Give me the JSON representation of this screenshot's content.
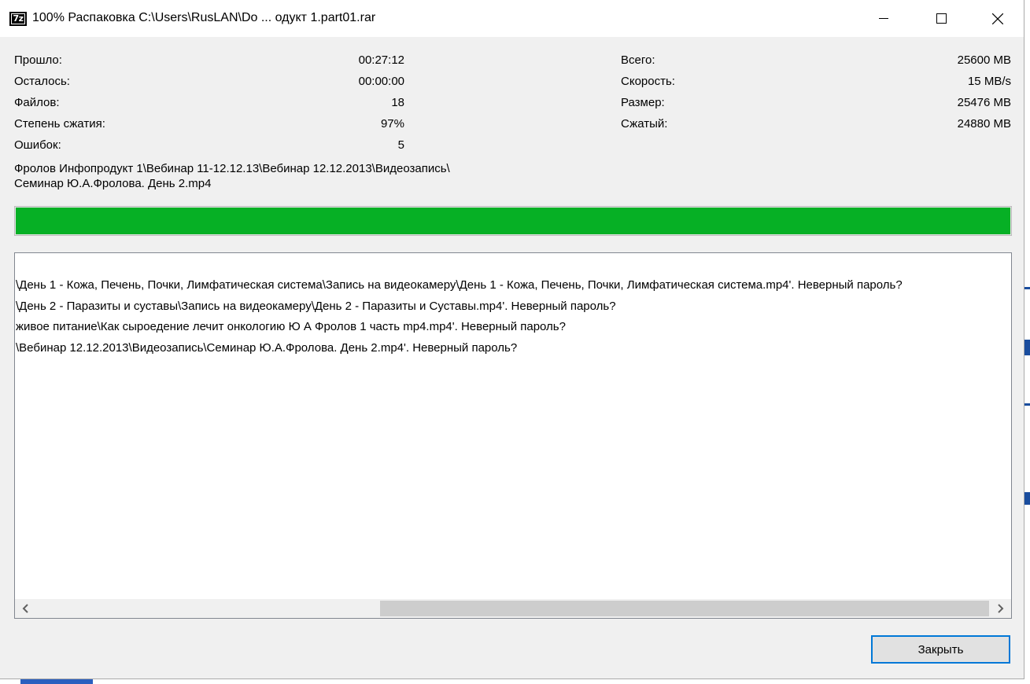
{
  "window": {
    "title": "100% Распаковка C:\\Users\\RusLAN\\Do ... одукт 1.part01.rar",
    "app_icon": "7z"
  },
  "stats_left": [
    {
      "label": "Прошло:",
      "value": "00:27:12"
    },
    {
      "label": "Осталось:",
      "value": "00:00:00"
    },
    {
      "label": "Файлов:",
      "value": "18"
    },
    {
      "label": "Степень сжатия:",
      "value": "97%"
    },
    {
      "label": "Ошибок:",
      "value": "5"
    }
  ],
  "stats_right": [
    {
      "label": "Всего:",
      "value": "25600 MB"
    },
    {
      "label": "Скорость:",
      "value": "15 MB/s"
    },
    {
      "label": "Размер:",
      "value": "25476 MB"
    },
    {
      "label": "Сжатый:",
      "value": "24880 MB"
    }
  ],
  "current_file": {
    "line1": "Фролов Инфопродукт 1\\Вебинар 11-12.12.13\\Вебинар 12.12.2013\\Видеозапись\\",
    "line2": "Семинар Ю.А.Фролова. День 2.mp4"
  },
  "progress": {
    "percent": 100,
    "color": "#06b025"
  },
  "log_lines": [
    "\\День 1 - Кожа, Печень, Почки, Лимфатическая система\\Запись на видеокамеру\\День 1 - Кожа, Печень, Почки, Лимфатическая система.mp4'. Неверный пароль?",
    "\\День 2 - Паразиты и суставы\\Запись на видеокамеру\\День 2 - Паразиты и Суставы.mp4'. Неверный пароль?",
    "живое питание\\Как сыроедение лечит онкологию Ю А Фролов 1 часть mp4.mp4'. Неверный пароль?",
    "\\Вебинар 12.12.2013\\Видеозапись\\Семинар Ю.А.Фролова. День 2.mp4'. Неверный пароль?"
  ],
  "buttons": {
    "close_label": "Закрыть"
  },
  "colors": {
    "accent": "#0078d7",
    "progress": "#06b025"
  },
  "icons": {
    "minimize": "minimize-icon",
    "maximize": "maximize-icon",
    "close": "close-icon",
    "scroll_left": "chevron-left-icon",
    "scroll_right": "chevron-right-icon"
  }
}
